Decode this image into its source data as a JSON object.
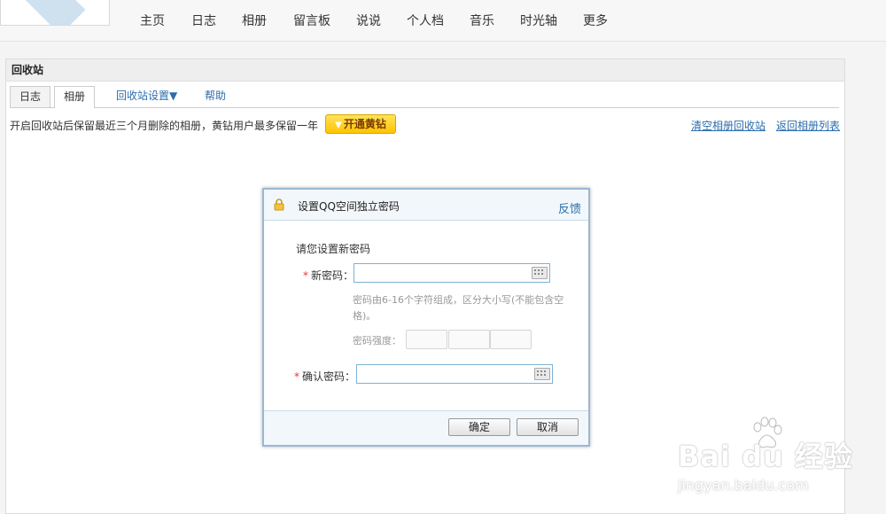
{
  "nav": {
    "items": [
      "主页",
      "日志",
      "相册",
      "留言板",
      "说说",
      "个人档",
      "音乐",
      "时光轴",
      "更多"
    ]
  },
  "panel": {
    "title": "回收站",
    "tabs": [
      "日志",
      "相册",
      "回收站设置▼",
      "帮助"
    ],
    "active_tab": "相册",
    "info_text": "开启回收站后保留最近三个月删除的相册，黄钻用户最多保留一年",
    "vip_button": "开通黄钻",
    "clear_link": "清空相册回收站",
    "back_link": "返回相册列表"
  },
  "dialog": {
    "title": "设置QQ空间独立密码",
    "feedback": "反馈",
    "prompt": "请您设置新密码",
    "new_password_label": "新密码：",
    "hint": "密码由6-16个字符组成，区分大小写(不能包含空格)。",
    "strength_label": "密码强度：",
    "confirm_password_label": "确认密码：",
    "required_mark": "*",
    "ok_button": "确定",
    "cancel_button": "取消"
  },
  "watermark": {
    "logo": "Bai du 经验",
    "url": "jingyan.baidu.com"
  },
  "colors": {
    "link": "#2b6dad",
    "vip_yellow": "#ffc400",
    "required": "#ee3333"
  }
}
